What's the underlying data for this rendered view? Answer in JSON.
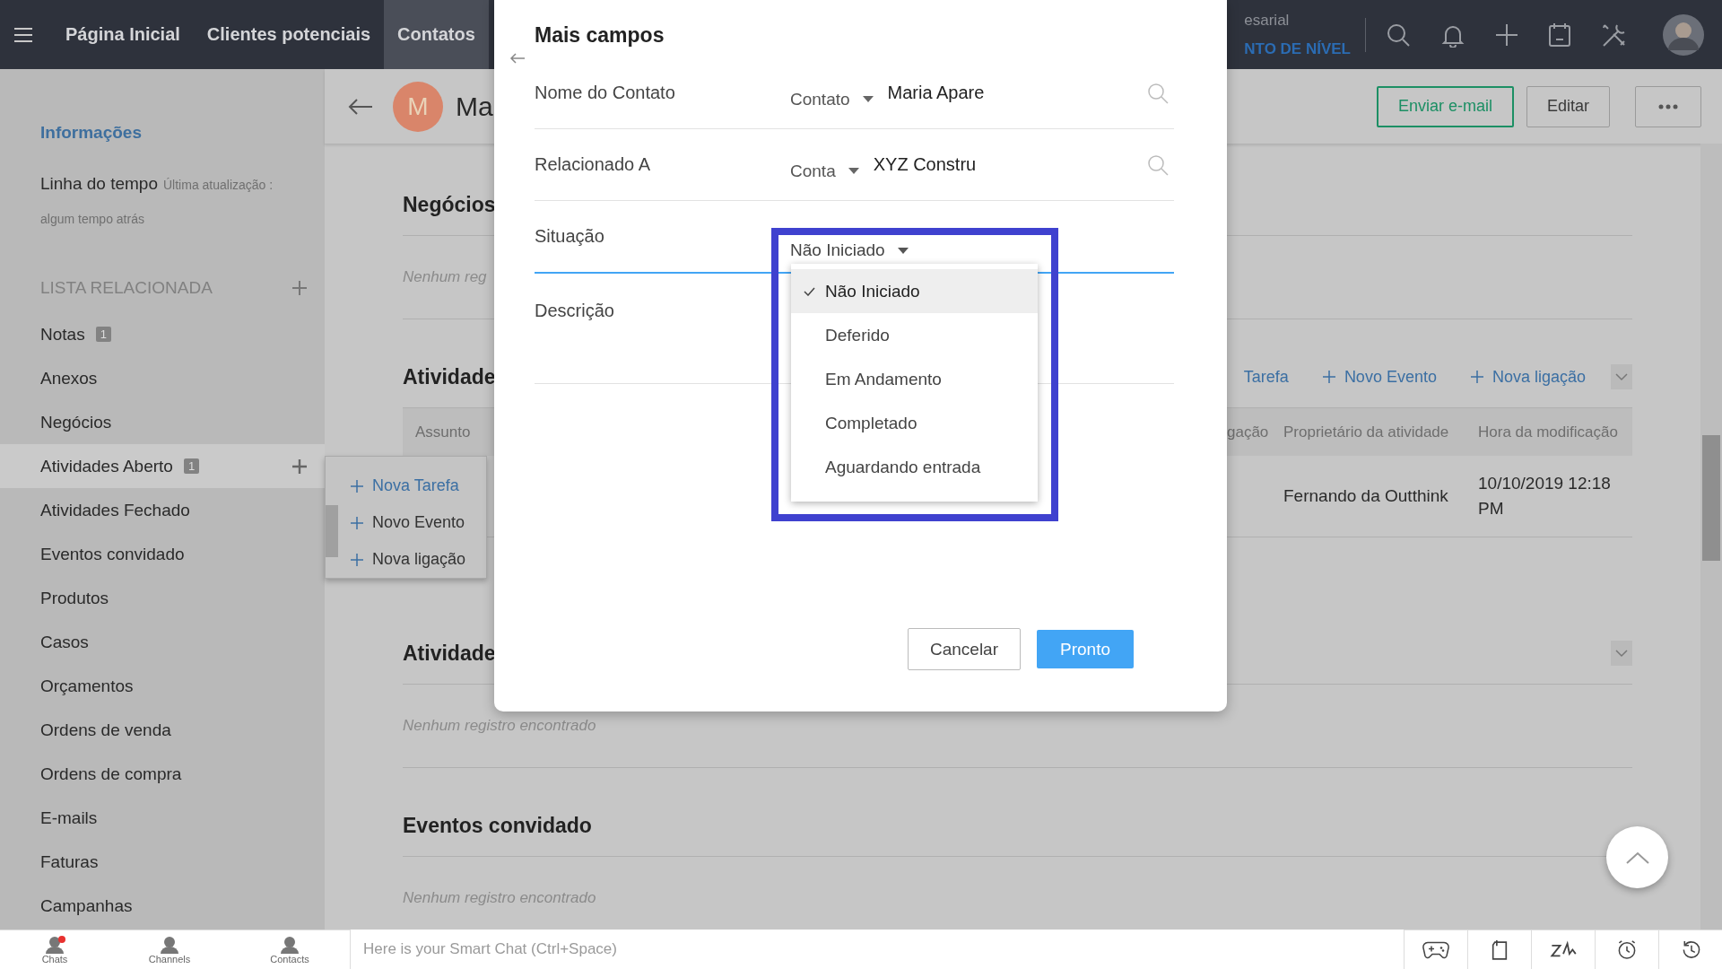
{
  "top_nav": {
    "items": [
      {
        "label": "Página Inicial",
        "selected": false
      },
      {
        "label": "Clientes potenciais",
        "selected": false
      },
      {
        "label": "Contatos",
        "selected": true
      }
    ],
    "org_name": "esarial",
    "org_subtitle": "NTO DE NÍVEL"
  },
  "sidebar": {
    "info_link": "Informações",
    "timeline_label": "Linha do tempo",
    "timeline_meta": "Última atualização :",
    "timeline_time": "algum tempo atrás",
    "section_title": "LISTA RELACIONADA",
    "items": [
      {
        "label": "Notas",
        "badge": "1",
        "selected": false,
        "add": false
      },
      {
        "label": "Anexos",
        "selected": false,
        "add": false
      },
      {
        "label": "Negócios",
        "selected": false,
        "add": false
      },
      {
        "label": "Atividades Aberto",
        "badge": "1",
        "selected": true,
        "add": true
      },
      {
        "label": "Atividades Fechado",
        "selected": false,
        "add": false
      },
      {
        "label": "Eventos convidado",
        "selected": false,
        "add": false
      },
      {
        "label": "Produtos",
        "selected": false,
        "add": false
      },
      {
        "label": "Casos",
        "selected": false,
        "add": false
      },
      {
        "label": "Orçamentos",
        "selected": false,
        "add": false
      },
      {
        "label": "Ordens de venda",
        "selected": false,
        "add": false
      },
      {
        "label": "Ordens de compra",
        "selected": false,
        "add": false
      },
      {
        "label": "E-mails",
        "selected": false,
        "add": false
      },
      {
        "label": "Faturas",
        "selected": false,
        "add": false
      },
      {
        "label": "Campanhas",
        "selected": false,
        "add": false
      }
    ]
  },
  "record": {
    "avatar_letter": "M",
    "name": "Ma",
    "buttons": [
      {
        "label": "Enviar e-mail",
        "kind": "outline"
      },
      {
        "label": "Editar",
        "kind": "plain"
      }
    ]
  },
  "sections": [
    {
      "kind": "empty",
      "title": "Negócios",
      "empty_text": "Nenhum reg",
      "collapsible": false
    },
    {
      "kind": "table",
      "title": "Atividade",
      "collapsible": true,
      "actions": [
        {
          "label": "Tarefa",
          "plus": false
        },
        {
          "label": "Novo Evento",
          "plus": true
        },
        {
          "label": "Nova ligação",
          "plus": true
        }
      ],
      "columns": [
        "Assunto",
        "gação",
        "Proprietário da atividade",
        "Hora da modificação"
      ],
      "rows": [
        {
          "owner": "Fernando da Outthink",
          "modified": "10/10/2019 12:18 PM"
        }
      ]
    },
    {
      "kind": "empty",
      "title": "Atividade",
      "empty_text": "Nenhum registro encontrado",
      "collapsible": true
    },
    {
      "kind": "empty",
      "title": "Eventos convidado",
      "empty_text": "Nenhum registro encontrado",
      "collapsible": false
    }
  ],
  "add_menu": [
    "Nova Tarefa",
    "Novo Evento",
    "Nova ligação"
  ],
  "modal": {
    "title": "Mais campos",
    "fields": [
      {
        "label": "Nome do Contato",
        "kind": "lookup",
        "type": "Contato",
        "value": "Maria Apare"
      },
      {
        "label": "Relacionado A",
        "kind": "lookup",
        "type": "Conta",
        "value": "XYZ Constru"
      },
      {
        "label": "Situação",
        "kind": "select",
        "value": "Não Iniciado",
        "expanded": true,
        "highlighted": true
      },
      {
        "label": "Descrição",
        "kind": "textarea"
      }
    ],
    "options": [
      {
        "label": "Não Iniciado",
        "selected": true
      },
      {
        "label": "Deferido",
        "selected": false
      },
      {
        "label": "Em Andamento",
        "selected": false
      },
      {
        "label": "Completado",
        "selected": false
      },
      {
        "label": "Aguardando entrada",
        "selected": false
      }
    ],
    "buttons": [
      {
        "label": "Cancelar",
        "kind": "secondary"
      },
      {
        "label": "Pronto",
        "kind": "primary"
      }
    ]
  },
  "chat_bar": {
    "tabs": [
      {
        "label": "Chats",
        "unread": true
      },
      {
        "label": "Channels",
        "unread": false
      },
      {
        "label": "Contacts",
        "unread": false
      }
    ],
    "placeholder": "Here is your Smart Chat (Ctrl+Space)"
  }
}
